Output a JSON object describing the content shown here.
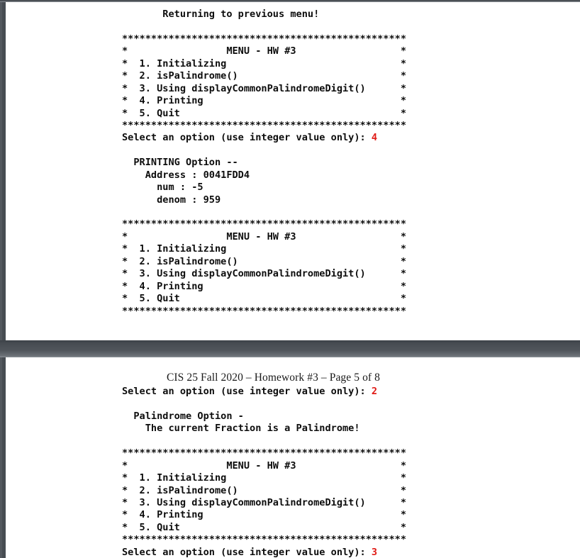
{
  "viewer": {
    "background_color": "#53585e",
    "page_background": "#ffffff",
    "accent_answer_color": "#e01b16",
    "text_color": "#0d0d0d"
  },
  "pages": [
    {
      "id": "page-top",
      "running_header": "",
      "lines": [
        {
          "text": "       Returning to previous menu!"
        },
        {
          "text": ""
        },
        {
          "text": "*************************************************"
        },
        {
          "text": "*                 MENU - HW #3                  *"
        },
        {
          "text": "*  1. Initializing                              *"
        },
        {
          "text": "*  2. isPalindrome()                            *"
        },
        {
          "text": "*  3. Using displayCommonPalindromeDigit()      *"
        },
        {
          "text": "*  4. Printing                                  *"
        },
        {
          "text": "*  5. Quit                                      *"
        },
        {
          "text": "*************************************************"
        },
        {
          "text": "Select an option (use integer value only): ",
          "answer": "4"
        },
        {
          "text": ""
        },
        {
          "text": "  PRINTING Option --"
        },
        {
          "text": "    Address : 0041FDD4"
        },
        {
          "text": "      num : -5"
        },
        {
          "text": "      denom : 959"
        },
        {
          "text": ""
        },
        {
          "text": "*************************************************"
        },
        {
          "text": "*                 MENU - HW #3                  *"
        },
        {
          "text": "*  1. Initializing                              *"
        },
        {
          "text": "*  2. isPalindrome()                            *"
        },
        {
          "text": "*  3. Using displayCommonPalindromeDigit()      *"
        },
        {
          "text": "*  4. Printing                                  *"
        },
        {
          "text": "*  5. Quit                                      *"
        },
        {
          "text": "*************************************************"
        }
      ]
    },
    {
      "id": "page-bottom",
      "running_header": "CIS 25 Fall 2020 – Homework #3 – Page 5 of 8",
      "lines": [
        {
          "text": "Select an option (use integer value only): ",
          "answer": "2"
        },
        {
          "text": ""
        },
        {
          "text": "  Palindrome Option -"
        },
        {
          "text": "    The current Fraction is a Palindrome!"
        },
        {
          "text": ""
        },
        {
          "text": "*************************************************"
        },
        {
          "text": "*                 MENU - HW #3                  *"
        },
        {
          "text": "*  1. Initializing                              *"
        },
        {
          "text": "*  2. isPalindrome()                            *"
        },
        {
          "text": "*  3. Using displayCommonPalindromeDigit()      *"
        },
        {
          "text": "*  4. Printing                                  *"
        },
        {
          "text": "*  5. Quit                                      *"
        },
        {
          "text": "*************************************************"
        },
        {
          "text": "Select an option (use integer value only): ",
          "answer": "3"
        }
      ]
    }
  ],
  "menu": {
    "title": "MENU - HW #3",
    "options": [
      {
        "number": "1.",
        "label": "Initializing"
      },
      {
        "number": "2.",
        "label": "isPalindrome()"
      },
      {
        "number": "3.",
        "label": "Using displayCommonPalindromeDigit()"
      },
      {
        "number": "4.",
        "label": "Printing"
      },
      {
        "number": "5.",
        "label": "Quit"
      }
    ],
    "prompt": "Select an option (use integer value only): ",
    "border_char": "*"
  },
  "program_output": {
    "returning_message": "Returning to previous menu!",
    "printing_option_title": "PRINTING Option --",
    "address_label": "Address :",
    "address_value": "0041FDD4",
    "num_label": "num :",
    "num_value": "-5",
    "denom_label": "denom :",
    "denom_value": "959",
    "palindrome_option_title": "Palindrome Option -",
    "palindrome_result": "The current Fraction is a Palindrome!"
  }
}
